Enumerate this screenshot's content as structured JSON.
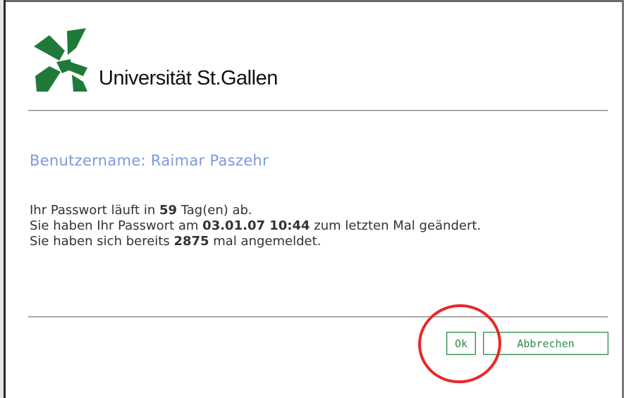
{
  "branding": {
    "university_name": "Universität St.Gallen",
    "logo_color": "#1f7a3a"
  },
  "user": {
    "label": "Benutzername: Raimar Paszehr"
  },
  "info": {
    "line1_prefix": "Ihr Passwort läuft in ",
    "line1_value": "59",
    "line1_suffix": " Tag(en) ab.",
    "line2_prefix": "Sie haben Ihr Passwort am ",
    "line2_value": "03.01.07 10:44",
    "line2_suffix": " zum letzten Mal geändert.",
    "line3_prefix": "Sie haben sich bereits ",
    "line3_value": "2875",
    "line3_suffix": " mal angemeldet."
  },
  "buttons": {
    "ok_label": "Ok",
    "cancel_label": "Abbrechen"
  },
  "annotation": {
    "color": "#e8282a"
  }
}
